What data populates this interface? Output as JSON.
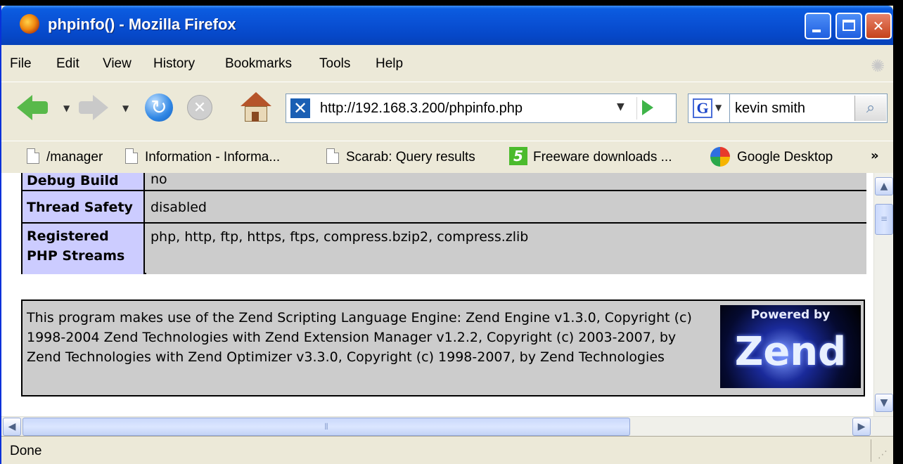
{
  "window": {
    "title": "phpinfo() - Mozilla Firefox"
  },
  "menu": [
    "File",
    "Edit",
    "View",
    "History",
    "Bookmarks",
    "Tools",
    "Help"
  ],
  "nav": {
    "url": "http://192.168.3.200/phpinfo.php",
    "search_value": "kevin smith"
  },
  "bookmarks": [
    {
      "label": "/manager",
      "icon": "page-icon"
    },
    {
      "label": "Information - Informa...",
      "icon": "page-icon"
    },
    {
      "label": "Scarab: Query results",
      "icon": "page-icon"
    },
    {
      "label": "Freeware downloads ...",
      "icon": "five-icon"
    },
    {
      "label": "Google Desktop",
      "icon": "google-desktop-icon"
    }
  ],
  "bookmarks_more": "»",
  "table": [
    {
      "key": "Debug Build",
      "value": "no"
    },
    {
      "key": "Thread Safety",
      "value": "disabled"
    },
    {
      "key": "Registered PHP Streams",
      "value": "php, http, ftp, https, ftps, compress.bzip2, compress.zlib"
    }
  ],
  "zend": {
    "text": "This program makes use of the Zend Scripting Language Engine: Zend Engine v1.3.0, Copyright (c) 1998-2004 Zend Technologies with Zend Extension Manager v1.2.2, Copyright (c) 2003-2007, by Zend Technologies with Zend Optimizer v3.3.0, Copyright (c) 1998-2007, by Zend Technologies",
    "logo_top": "Powered by",
    "logo_word": "Zend"
  },
  "status": "Done",
  "colors": {
    "titlebar": "#0a52d6",
    "chrome": "#ece9d8",
    "table_key": "#ccccff",
    "table_value": "#cccccc"
  }
}
